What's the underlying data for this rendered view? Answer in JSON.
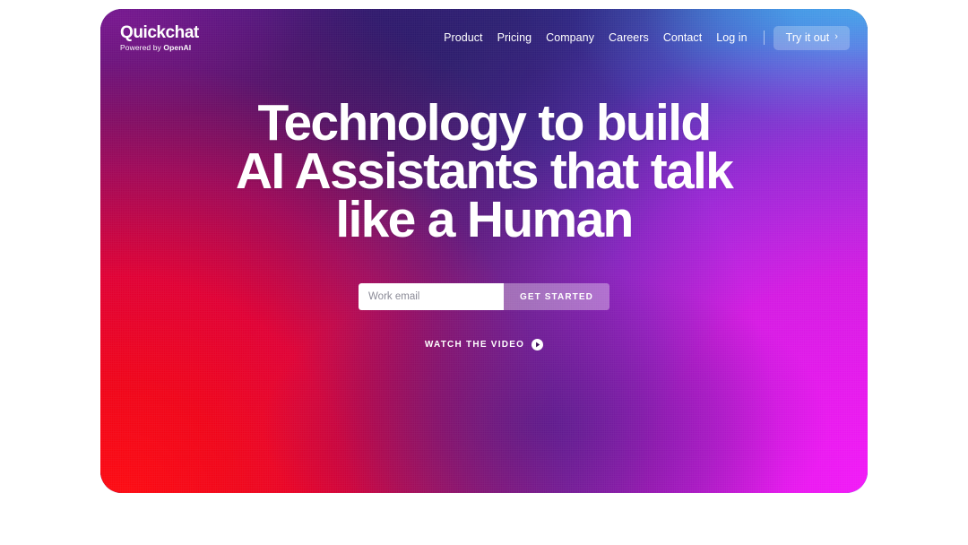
{
  "brand": {
    "name": "Quickchat",
    "tagline_prefix": "Powered by ",
    "tagline_strong": "OpenAI"
  },
  "nav": {
    "links": [
      {
        "label": "Product"
      },
      {
        "label": "Pricing"
      },
      {
        "label": "Company"
      },
      {
        "label": "Careers"
      },
      {
        "label": "Contact"
      },
      {
        "label": "Log in"
      }
    ],
    "cta_label": "Try it out",
    "cta_chevron": "›"
  },
  "hero": {
    "headline_line1": "Technology to build",
    "headline_line2": "AI Assistants that talk",
    "headline_line3": "like a Human",
    "email_placeholder": "Work email",
    "email_value": "",
    "submit_label": "GET STARTED",
    "watch_label": "WATCH THE VIDEO",
    "play_icon": "play-circle-icon"
  },
  "colors": {
    "top_left_violet": "#5d1a96",
    "top_mid_navy": "#16195c",
    "top_right_cyan": "#1ae4ef",
    "bottom_left_red": "#f00419",
    "bottom_right_magenta": "#e518ec",
    "page_background": "#ffffff",
    "text_on_hero": "#ffffff",
    "input_background": "#ffffff",
    "input_placeholder": "#8b8b97"
  }
}
